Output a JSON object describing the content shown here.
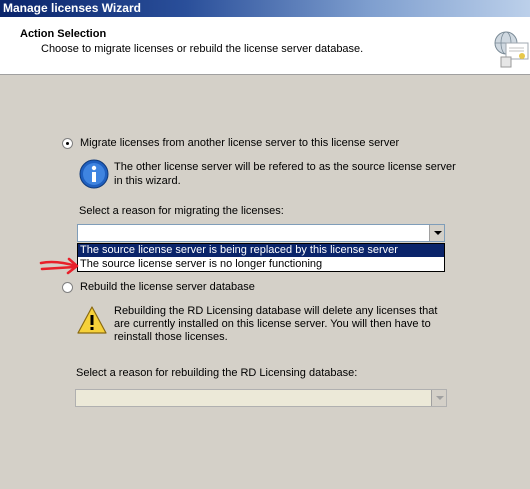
{
  "window": {
    "title": "Manage licenses Wizard"
  },
  "header": {
    "title": "Action Selection",
    "subtitle": "Choose to migrate licenses or rebuild the license server database."
  },
  "migrate": {
    "radio_label": "Migrate licenses from another license server to this license server",
    "checked": true,
    "info_text_line1": "The other license server will be refered to as the source license server",
    "info_text_line2": "in this wizard.",
    "reason_label": "Select a reason for migrating the licenses:",
    "reason_value": "",
    "options": [
      "The source license server is being replaced by this license server",
      "The source license server is no longer functioning"
    ],
    "highlighted_option": 0
  },
  "rebuild": {
    "radio_label": "Rebuild the license server database",
    "checked": false,
    "warning_line1": "Rebuilding the RD Licensing database will delete any licenses that",
    "warning_line2": "are currently installed on this license server. You will then have to",
    "warning_line3": "reinstall those licenses.",
    "reason_label": "Select a reason for rebuilding the RD Licensing database:",
    "reason_value": "",
    "disabled": true
  },
  "icons": {
    "header": "certificate-globe-icon",
    "info": "info-icon",
    "warning": "warning-icon",
    "annotation": "red-arrow-annotation-icon"
  },
  "colors": {
    "dialog_bg": "#d4d0c8",
    "selection": "#0a246a",
    "annotation": "#e8202a",
    "info_blue": "#1f5fbf",
    "warning_yellow": "#f6d13a"
  }
}
